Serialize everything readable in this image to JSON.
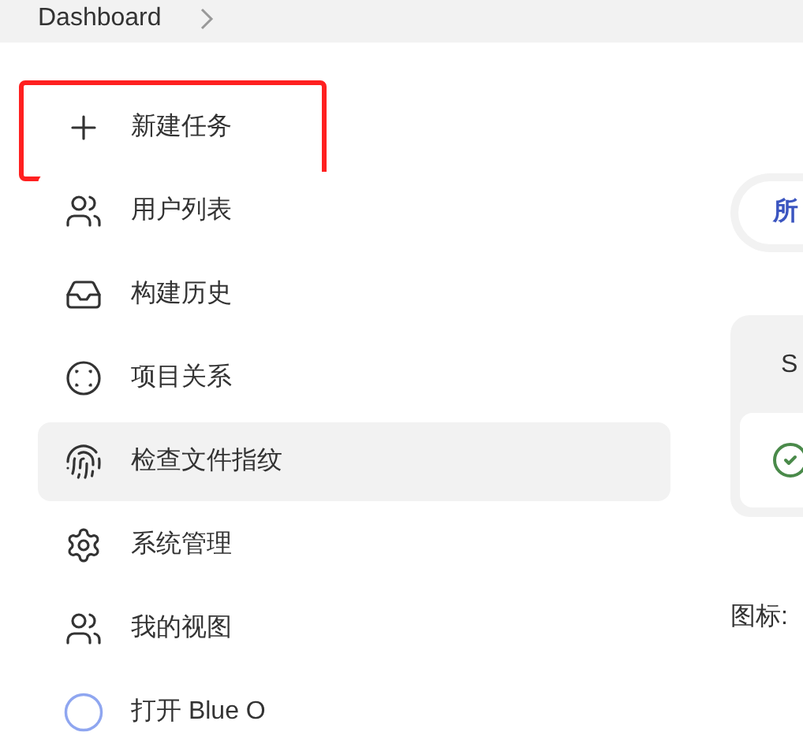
{
  "breadcrumb": {
    "items": [
      "Dashboard"
    ]
  },
  "sidebar": {
    "items": [
      {
        "label": "新建任务",
        "kind": "plus",
        "selected": false,
        "annotated": true
      },
      {
        "label": "用户列表",
        "kind": "users",
        "selected": false,
        "annotated": false
      },
      {
        "label": "构建历史",
        "kind": "inbox",
        "selected": false,
        "annotated": false
      },
      {
        "label": "项目关系",
        "kind": "relation",
        "selected": false,
        "annotated": false
      },
      {
        "label": "检查文件指纹",
        "kind": "fingerprint",
        "selected": true,
        "annotated": false
      },
      {
        "label": "系统管理",
        "kind": "settings",
        "selected": false,
        "annotated": false
      },
      {
        "label": "我的视图",
        "kind": "users",
        "selected": false,
        "annotated": false
      },
      {
        "label": "打开 Blue O",
        "kind": "ring",
        "selected": false,
        "annotated": false
      }
    ]
  },
  "main": {
    "tab": "所",
    "card": {
      "title": "S"
    },
    "legend": "图标:"
  }
}
